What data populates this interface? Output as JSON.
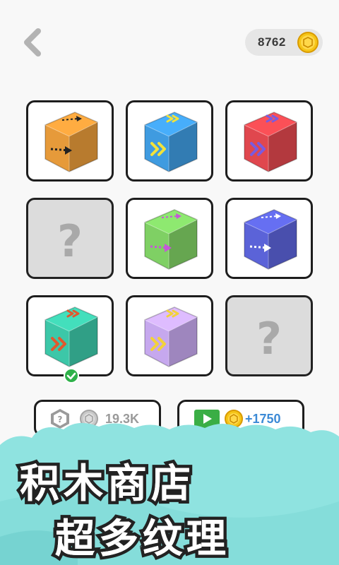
{
  "header": {
    "back_icon": "chevron-left-icon",
    "coins": "8762",
    "coin_icon": "gold-coin-icon"
  },
  "skins": [
    {
      "state": "owned",
      "color": "#e69a3a",
      "arrow_color": "#222222",
      "arrow_icon": "arrow-right-icon"
    },
    {
      "state": "owned",
      "color": "#3f9be0",
      "arrow_color": "#f2e23a",
      "arrow_icon": "double-chevron-icon"
    },
    {
      "state": "owned",
      "color": "#e0474e",
      "arrow_color": "#7a5be0",
      "arrow_icon": "double-chevron-icon"
    },
    {
      "state": "locked",
      "symbol": "?"
    },
    {
      "state": "owned",
      "color": "#7fd064",
      "arrow_color": "#c657d8",
      "arrow_icon": "arrow-right-icon"
    },
    {
      "state": "owned",
      "color": "#5b63d8",
      "arrow_color": "#ffffff",
      "arrow_icon": "arrow-right-icon"
    },
    {
      "state": "selected",
      "color": "#3cc7a8",
      "arrow_color": "#e2572e",
      "arrow_icon": "double-chevron-icon"
    },
    {
      "state": "owned",
      "color": "#c6a8ee",
      "arrow_color": "#f2d23a",
      "arrow_icon": "double-chevron-icon"
    },
    {
      "state": "locked",
      "symbol": "?"
    }
  ],
  "buy_button": {
    "label": "19.3K",
    "cube_icon": "random-cube-icon",
    "coin_icon": "silver-coin-icon"
  },
  "video_button": {
    "label": "+1750",
    "video_icon": "play-video-icon",
    "coin_icon": "gold-coin-icon"
  },
  "banner": {
    "line1": "积木商店",
    "line2": "超多纹理",
    "color": "#8fe3e0"
  },
  "colors": {
    "accent_blue": "#3c8ad6",
    "check_green": "#2fb14a"
  }
}
